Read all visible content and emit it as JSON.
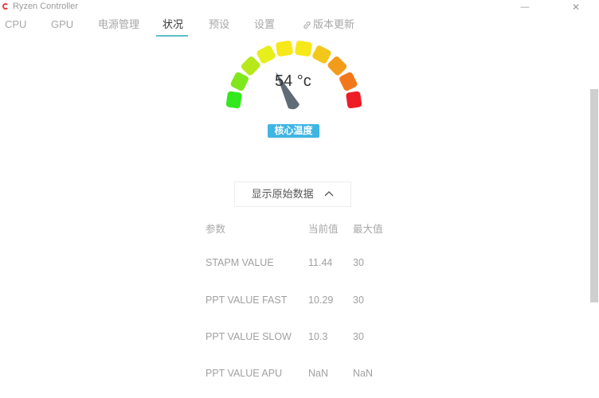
{
  "window": {
    "title": "Ryzen Controller",
    "minimize_glyph": "—",
    "close_glyph": "✕"
  },
  "tabs": [
    {
      "label": "CPU"
    },
    {
      "label": "GPU"
    },
    {
      "label": "电源管理"
    },
    {
      "label": "状况",
      "active": true
    },
    {
      "label": "预设"
    },
    {
      "label": "设置"
    },
    {
      "label": "版本更新",
      "icon": "link-icon"
    }
  ],
  "gauge": {
    "value": 54,
    "unit": "°c",
    "display": "54 °c",
    "label": "核心温度",
    "segment_colors": [
      "#33e81c",
      "#7ee81c",
      "#b6e81c",
      "#e6ee1c",
      "#f7e81a",
      "#f7e81a",
      "#f3c71a",
      "#f39c1a",
      "#f2771a",
      "#ee1c25"
    ]
  },
  "raw_toggle": {
    "label": "显示原始数据",
    "expanded": true
  },
  "table": {
    "headers": [
      "参数",
      "当前值",
      "最大值"
    ],
    "rows": [
      [
        "STAPM VALUE",
        "11.44",
        "30"
      ],
      [
        "PPT VALUE FAST",
        "10.29",
        "30"
      ],
      [
        "PPT VALUE SLOW",
        "10.3",
        "30"
      ],
      [
        "PPT VALUE APU",
        "NaN",
        "NaN"
      ]
    ]
  },
  "colors": {
    "accent": "#5bc0c6",
    "badge": "#3fb5e4",
    "needle": "#5f6b77"
  }
}
